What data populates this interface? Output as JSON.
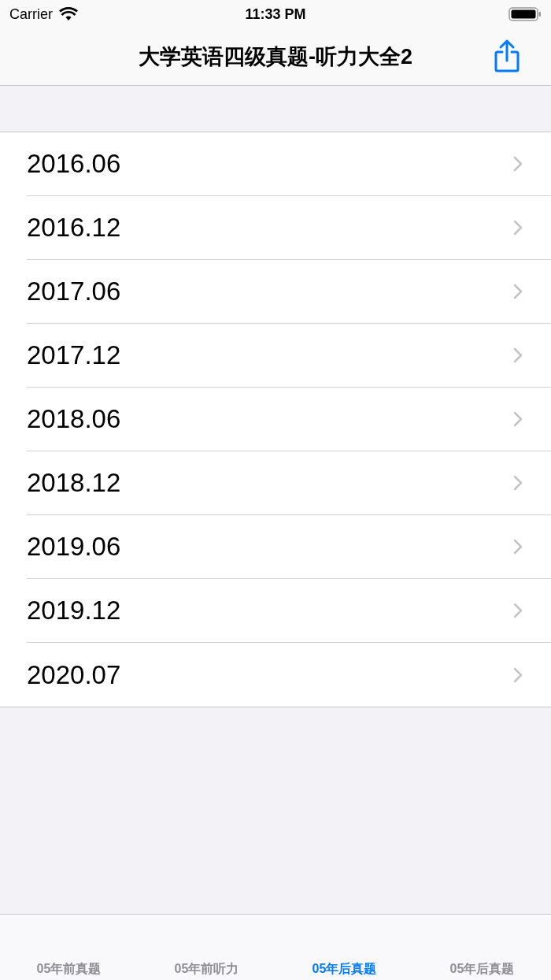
{
  "status_bar": {
    "carrier": "Carrier",
    "time": "11:33 PM"
  },
  "nav_bar": {
    "title": "大学英语四级真题-听力大全2"
  },
  "list": {
    "items": [
      {
        "label": "2016.06"
      },
      {
        "label": "2016.12"
      },
      {
        "label": "2017.06"
      },
      {
        "label": "2017.12"
      },
      {
        "label": "2018.06"
      },
      {
        "label": "2018.12"
      },
      {
        "label": "2019.06"
      },
      {
        "label": "2019.12"
      },
      {
        "label": "2020.07"
      }
    ]
  },
  "tab_bar": {
    "tabs": [
      {
        "label": "05年前真题",
        "selected": false
      },
      {
        "label": "05年前听力",
        "selected": false
      },
      {
        "label": "05年后真题",
        "selected": true
      },
      {
        "label": "05年后真题",
        "selected": false
      }
    ]
  }
}
